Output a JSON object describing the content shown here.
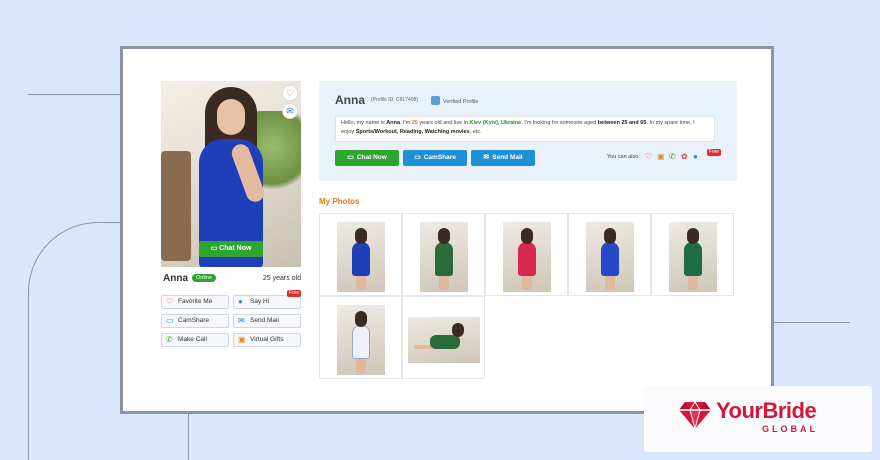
{
  "profile": {
    "name": "Anna",
    "online_label": "Online",
    "age_label": "25 years old",
    "profile_id": "(Profile ID: C917408)",
    "verified_label": "Verified Profile",
    "photo_chat_button": "Chat Now"
  },
  "side_actions": [
    {
      "label": "Favorite Me",
      "icon": "heart-icon",
      "color": "#e24a4a"
    },
    {
      "label": "Say Hi",
      "icon": "chat-bubble-icon",
      "color": "#3a86d4",
      "badge": "Free"
    },
    {
      "label": "CamShare",
      "icon": "camshare-icon",
      "color": "#2b7fd0"
    },
    {
      "label": "Send Mail",
      "icon": "mail-icon",
      "color": "#2b7fd0"
    },
    {
      "label": "Make Call",
      "icon": "phone-icon",
      "color": "#2ea52e"
    },
    {
      "label": "Virtual Gifts",
      "icon": "gift-icon",
      "color": "#e88a1c"
    }
  ],
  "bio": {
    "p1": "Hello, my name is ",
    "name": "Anna",
    "p2": ". I'm ",
    "age": "25",
    "p3": " years old and live in ",
    "city": "Kiev (Kyiv), Ukraine",
    "p4": ". I'm looking for someone aged ",
    "range": "between 25 and 65",
    "p5": ". In my spare time, I enjoy ",
    "hobbies": "Sports/Workout, Reading, Watching movies",
    "p6": ", etc."
  },
  "contact_buttons": [
    {
      "label": "Chat Now",
      "color": "#2ea52e"
    },
    {
      "label": "CamShare",
      "color": "#1f8fd6"
    },
    {
      "label": "Send Mail",
      "color": "#1f8fd6"
    }
  ],
  "also_label": "You can also:",
  "also_free_badge": "Free",
  "photos_title": "My Photos",
  "photos": [
    {
      "dress": "#1f3fb8"
    },
    {
      "dress": "#2a6b3a"
    },
    {
      "dress": "#d6284f"
    },
    {
      "dress": "#2748c8"
    },
    {
      "dress": "#1f6b42"
    },
    {
      "dress": "#eef0f8"
    },
    {
      "dress": "#2a6b3a"
    }
  ],
  "brand": {
    "name": "YourBride",
    "tagline": "GLOBAL",
    "color": "#d1183b"
  }
}
